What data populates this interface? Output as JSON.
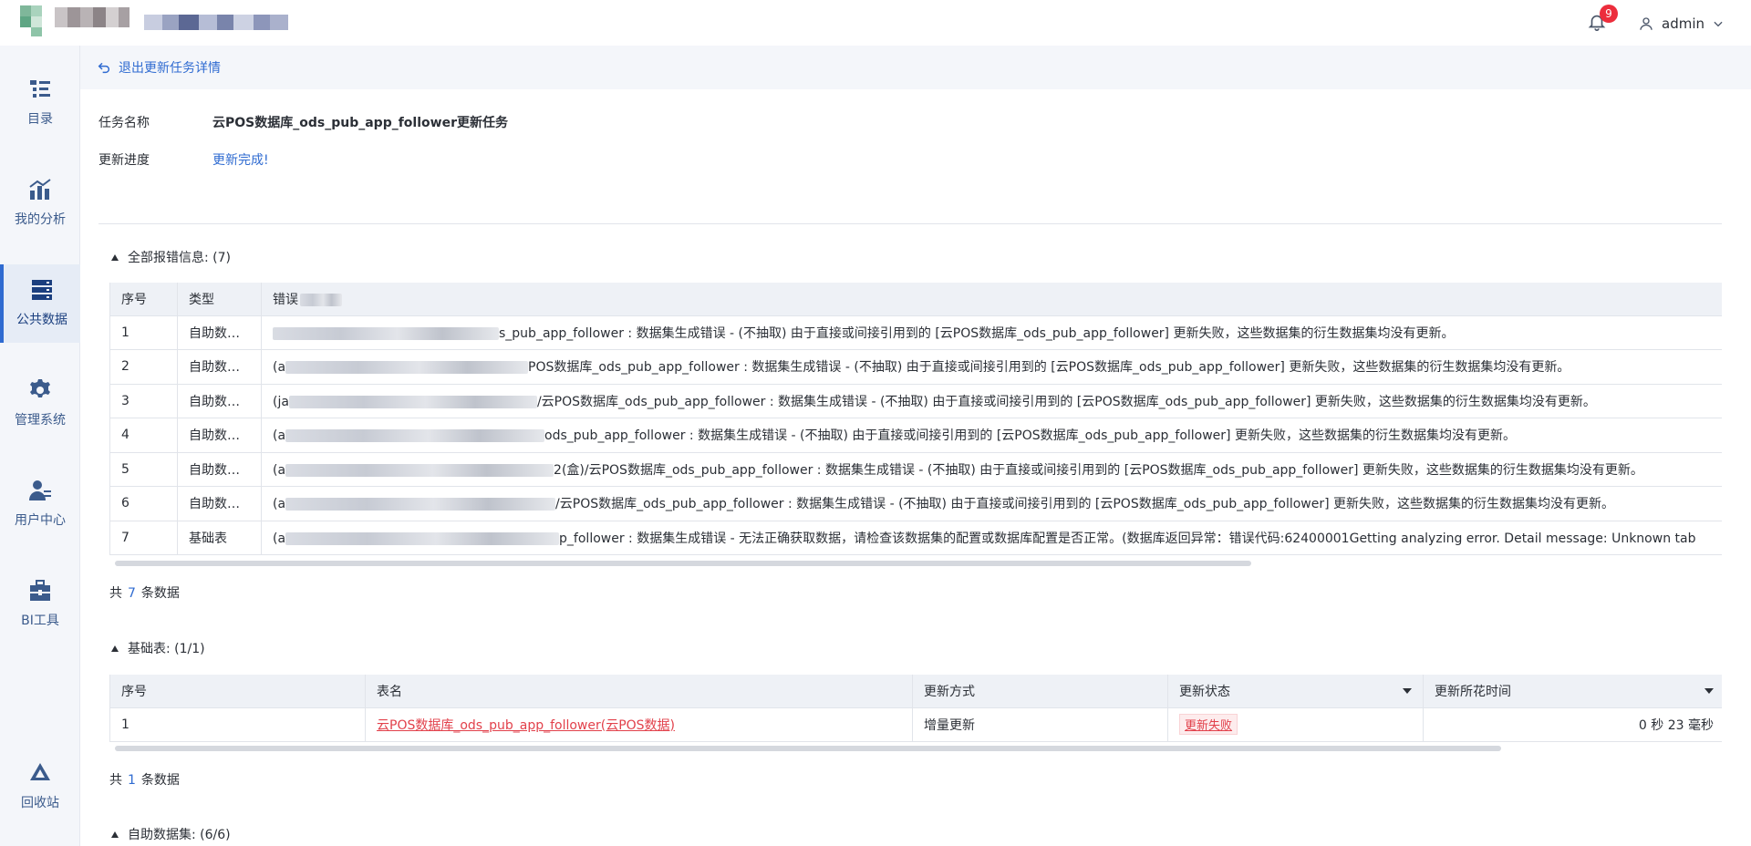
{
  "header": {
    "notification_count": "9",
    "user_name": "admin"
  },
  "sidebar": {
    "items": [
      {
        "label": "目录",
        "icon": "catalog-icon"
      },
      {
        "label": "我的分析",
        "icon": "analysis-icon"
      },
      {
        "label": "公共数据",
        "icon": "database-icon",
        "active": true
      },
      {
        "label": "管理系统",
        "icon": "settings-gear-icon"
      },
      {
        "label": "用户中心",
        "icon": "user-center-icon"
      },
      {
        "label": "BI工具",
        "icon": "toolbox-icon"
      },
      {
        "label": "回收站",
        "icon": "recycle-icon"
      }
    ]
  },
  "back": {
    "label": "退出更新任务详情"
  },
  "task": {
    "name_label": "任务名称",
    "name_value": "云POS数据库_ods_pub_app_follower更新任务",
    "progress_label": "更新进度",
    "progress_value": "更新完成!"
  },
  "errors": {
    "title": "全部报错信息: (7)",
    "columns": [
      "序号",
      "类型",
      "错误"
    ],
    "rows": [
      {
        "no": "1",
        "type": "自助数据集",
        "prefix": "",
        "message": "s_pub_app_follower : 数据集生成错误 - (不抽取) 由于直接或间接引用到的 [云POS数据库_ods_pub_app_follower] 更新失败，这些数据集的衍生数据集均没有更新。"
      },
      {
        "no": "2",
        "type": "自助数据集",
        "prefix": "(a",
        "message": "POS数据库_ods_pub_app_follower : 数据集生成错误 - (不抽取) 由于直接或间接引用到的 [云POS数据库_ods_pub_app_follower] 更新失败，这些数据集的衍生数据集均没有更新。"
      },
      {
        "no": "3",
        "type": "自助数据集",
        "prefix": "(ja",
        "message": "/云POS数据库_ods_pub_app_follower : 数据集生成错误 - (不抽取) 由于直接或间接引用到的 [云POS数据库_ods_pub_app_follower] 更新失败，这些数据集的衍生数据集均没有更新。"
      },
      {
        "no": "4",
        "type": "自助数据集",
        "prefix": "(a",
        "message": "ods_pub_app_follower : 数据集生成错误 - (不抽取) 由于直接或间接引用到的 [云POS数据库_ods_pub_app_follower] 更新失败，这些数据集的衍生数据集均没有更新。"
      },
      {
        "no": "5",
        "type": "自助数据集",
        "prefix": "(a",
        "message": "2(盒)/云POS数据库_ods_pub_app_follower : 数据集生成错误 - (不抽取) 由于直接或间接引用到的 [云POS数据库_ods_pub_app_follower] 更新失败，这些数据集的衍生数据集均没有更新。"
      },
      {
        "no": "6",
        "type": "自助数据集",
        "prefix": "(a",
        "message": "/云POS数据库_ods_pub_app_follower : 数据集生成错误 - (不抽取) 由于直接或间接引用到的 [云POS数据库_ods_pub_app_follower] 更新失败，这些数据集的衍生数据集均没有更新。"
      },
      {
        "no": "7",
        "type": "基础表",
        "prefix": "(a",
        "message": "p_follower : 数据集生成错误 - 无法正确获取数据，请检查该数据集的配置或数据库配置是否正常。(数据库返回异常：错误代码:62400001Getting analyzing error. Detail message: Unknown tab"
      }
    ],
    "count_prefix": "共",
    "count": "7",
    "count_suffix": "条数据"
  },
  "base_tables": {
    "title": "基础表: (1/1)",
    "columns": [
      "序号",
      "表名",
      "更新方式",
      "更新状态",
      "更新所花时间"
    ],
    "rows": [
      {
        "no": "1",
        "table_name": "云POS数据库_ods_pub_app_follower(云POS数据)",
        "method": "增量更新",
        "status": "更新失败",
        "duration": "0 秒 23 毫秒"
      }
    ],
    "count_prefix": "共",
    "count": "1",
    "count_suffix": "条数据"
  },
  "self_datasets": {
    "title": "自助数据集: (6/6)"
  },
  "colors": {
    "accent": "#2f6bd1",
    "error": "#e2414b",
    "badge": "#ec2d3c"
  }
}
